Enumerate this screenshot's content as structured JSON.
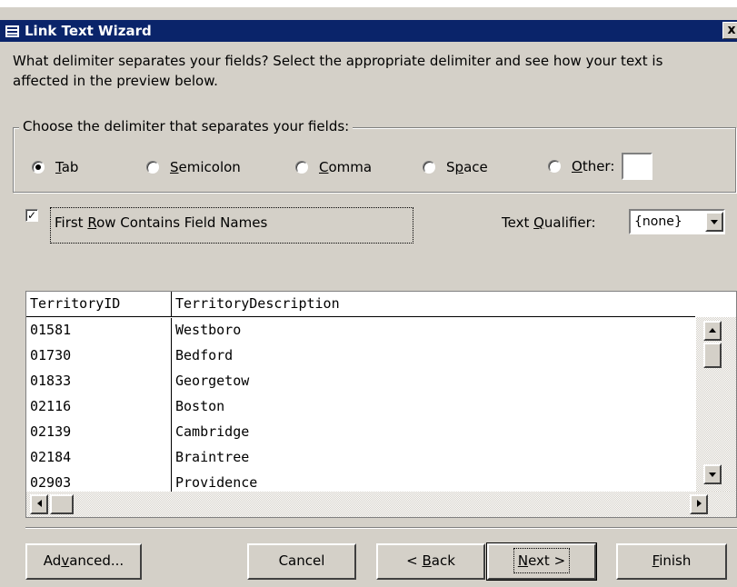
{
  "window": {
    "title": "Link Text Wizard",
    "close_glyph": "x"
  },
  "intro": {
    "text": "What delimiter separates your fields? Select the appropriate delimiter and see how your text is affected in the preview below."
  },
  "delimiter_group": {
    "label": "Choose the delimiter that separates your fields:",
    "options": [
      {
        "pre": "",
        "accel": "T",
        "post": "ab",
        "selected": true
      },
      {
        "pre": "",
        "accel": "S",
        "post": "emicolon",
        "selected": false
      },
      {
        "pre": "",
        "accel": "C",
        "post": "omma",
        "selected": false
      },
      {
        "pre": "S",
        "accel": "p",
        "post": "ace",
        "selected": false
      },
      {
        "pre": "",
        "accel": "O",
        "post": "ther:",
        "selected": false
      }
    ],
    "other_value": ""
  },
  "first_row": {
    "checked": true,
    "check_glyph": "✓",
    "pre": "First ",
    "accel": "R",
    "post": "ow Contains Field Names"
  },
  "qualifier": {
    "pre": "Text ",
    "accel": "Q",
    "post": "ualifier:",
    "value": "{none}"
  },
  "preview": {
    "headers": [
      "TerritoryID",
      "TerritoryDescription"
    ],
    "rows": [
      [
        "01581",
        "Westboro"
      ],
      [
        "01730",
        "Bedford"
      ],
      [
        "01833",
        "Georgetow"
      ],
      [
        "02116",
        "Boston"
      ],
      [
        "02139",
        "Cambridge"
      ],
      [
        "02184",
        "Braintree"
      ],
      [
        "02903",
        "Providence"
      ]
    ]
  },
  "buttons": {
    "advanced": {
      "pre": "Ad",
      "accel": "v",
      "post": "anced..."
    },
    "cancel": "Cancel",
    "back": {
      "pre": "< ",
      "accel": "B",
      "post": "ack"
    },
    "next": {
      "pre": "",
      "accel": "N",
      "post": "ext >"
    },
    "finish": {
      "pre": "",
      "accel": "F",
      "post": "inish"
    }
  }
}
